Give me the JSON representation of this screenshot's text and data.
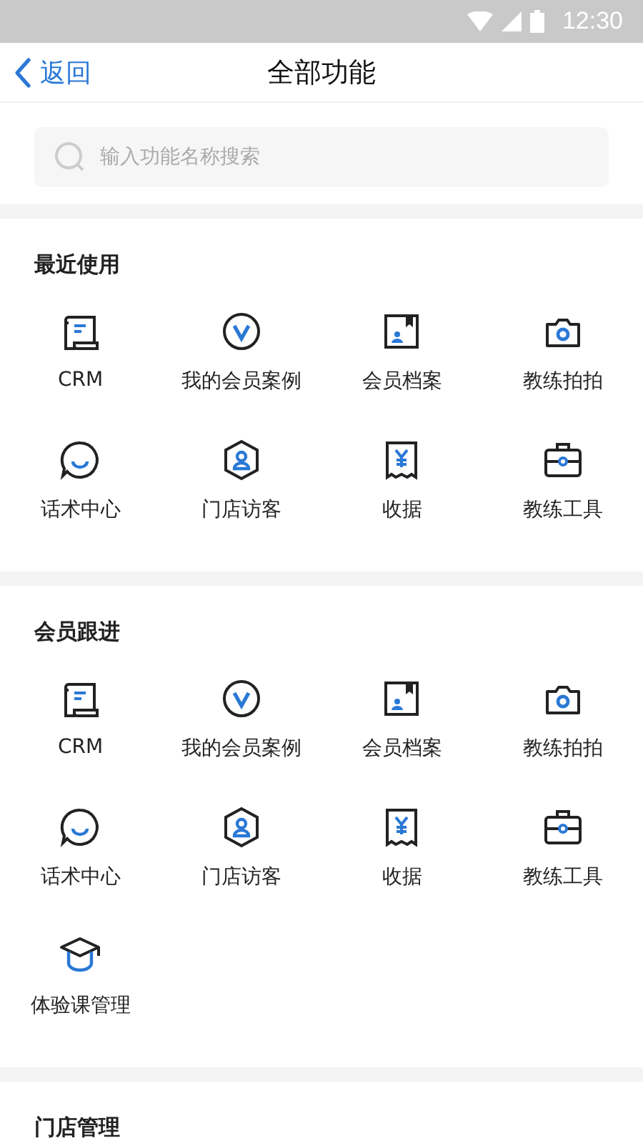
{
  "status_bar": {
    "time": "12:30"
  },
  "header": {
    "back": "返回",
    "title": "全部功能"
  },
  "search": {
    "placeholder": "输入功能名称搜索"
  },
  "sections": [
    {
      "title": "最近使用",
      "items": [
        {
          "label": "CRM",
          "kind": "scroll"
        },
        {
          "label": "我的会员案例",
          "kind": "badge"
        },
        {
          "label": "会员档案",
          "kind": "profile"
        },
        {
          "label": "教练拍拍",
          "kind": "camera"
        },
        {
          "label": "话术中心",
          "kind": "chat"
        },
        {
          "label": "门店访客",
          "kind": "visitor"
        },
        {
          "label": "收据",
          "kind": "receipt"
        },
        {
          "label": "教练工具",
          "kind": "toolbox"
        }
      ]
    },
    {
      "title": "会员跟进",
      "items": [
        {
          "label": "CRM",
          "kind": "scroll"
        },
        {
          "label": "我的会员案例",
          "kind": "badge"
        },
        {
          "label": "会员档案",
          "kind": "profile"
        },
        {
          "label": "教练拍拍",
          "kind": "camera"
        },
        {
          "label": "话术中心",
          "kind": "chat"
        },
        {
          "label": "门店访客",
          "kind": "visitor"
        },
        {
          "label": "收据",
          "kind": "receipt"
        },
        {
          "label": "教练工具",
          "kind": "toolbox"
        },
        {
          "label": "体验课管理",
          "kind": "cap"
        }
      ]
    },
    {
      "title": "门店管理"
    }
  ]
}
